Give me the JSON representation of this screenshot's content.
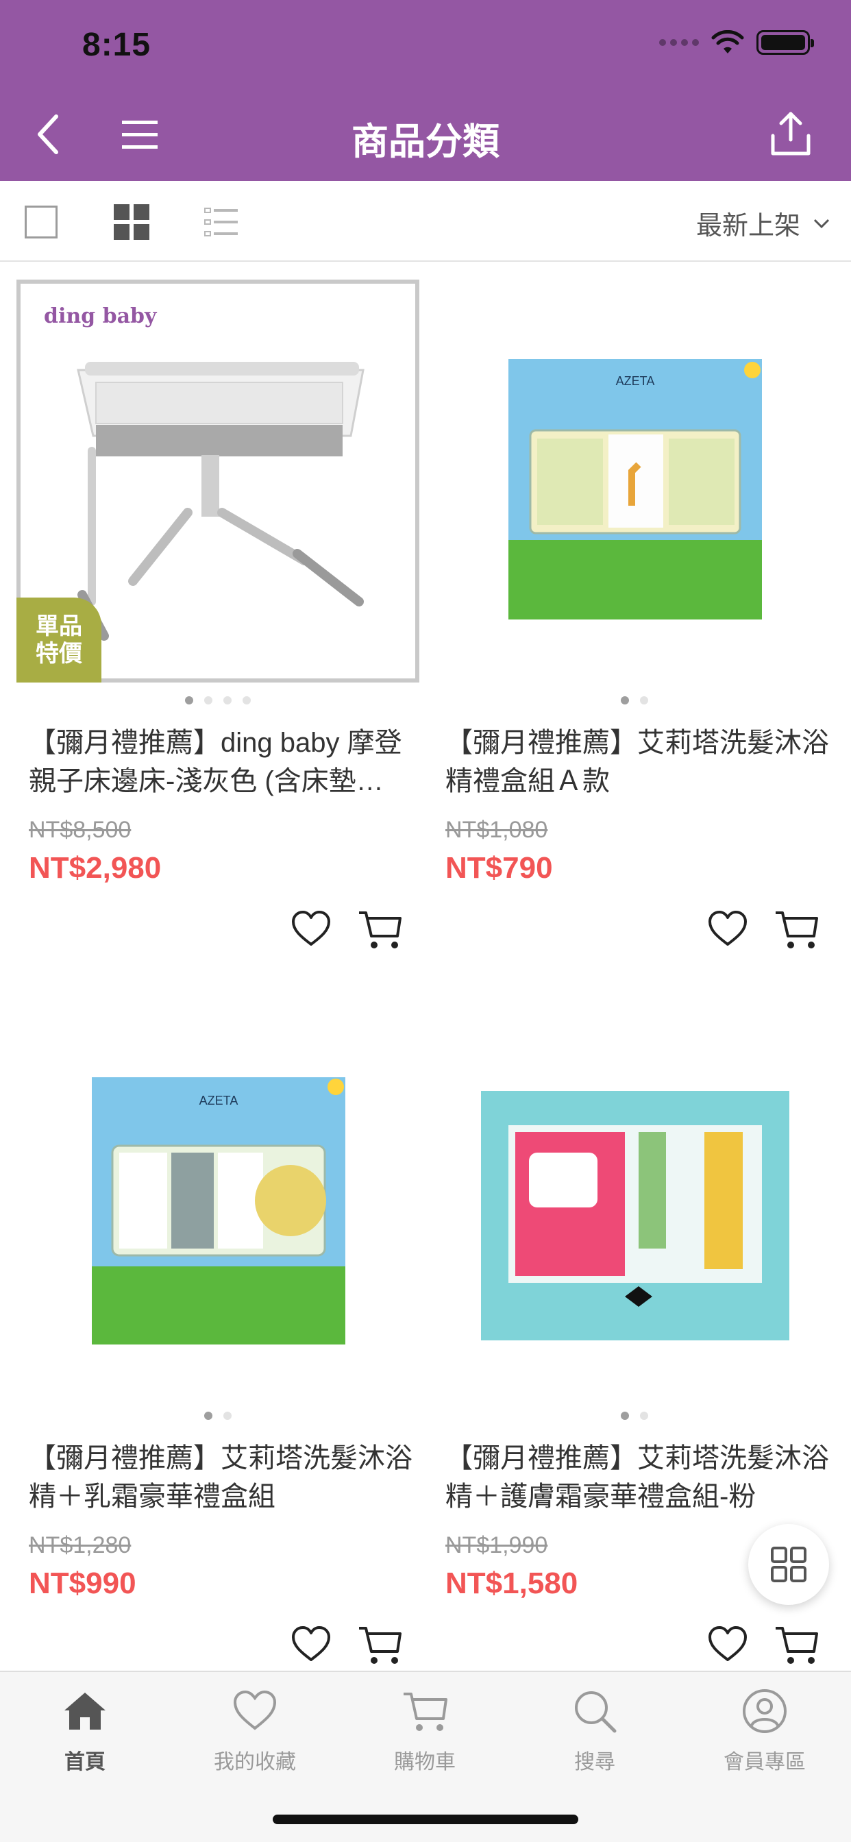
{
  "status": {
    "time": "8:15"
  },
  "header": {
    "title": "商品分類"
  },
  "toolbar": {
    "sort_label": "最新上架"
  },
  "products": [
    {
      "title": "【彌月禮推薦】ding baby 摩登親子床邊床-淺灰色 (含床墊…",
      "original_price": "NT$8,500",
      "price": "NT$2,980",
      "badge": "單品\n特價",
      "badge_line1": "單品",
      "badge_line2": "特價",
      "brand_text": "ding baby",
      "image_count": 4
    },
    {
      "title": "【彌月禮推薦】艾莉塔洗髮沐浴精禮盒組Ａ款",
      "original_price": "NT$1,080",
      "price": "NT$790",
      "image_count": 2
    },
    {
      "title": "【彌月禮推薦】艾莉塔洗髮沐浴精＋乳霜豪華禮盒組",
      "original_price": "NT$1,280",
      "price": "NT$990",
      "image_count": 2
    },
    {
      "title": "【彌月禮推薦】艾莉塔洗髮沐浴精＋護膚霜豪華禮盒組-粉",
      "original_price": "NT$1,990",
      "price": "NT$1,580",
      "image_count": 2
    }
  ],
  "tabbar": {
    "items": [
      {
        "label": "首頁",
        "icon": "home-icon",
        "active": true
      },
      {
        "label": "我的收藏",
        "icon": "heart-icon",
        "active": false
      },
      {
        "label": "購物車",
        "icon": "cart-icon",
        "active": false
      },
      {
        "label": "搜尋",
        "icon": "search-icon",
        "active": false
      },
      {
        "label": "會員專區",
        "icon": "user-icon",
        "active": false
      }
    ]
  },
  "colors": {
    "header": "#9457a3",
    "price": "#f25555",
    "badge": "#a8ad44"
  }
}
